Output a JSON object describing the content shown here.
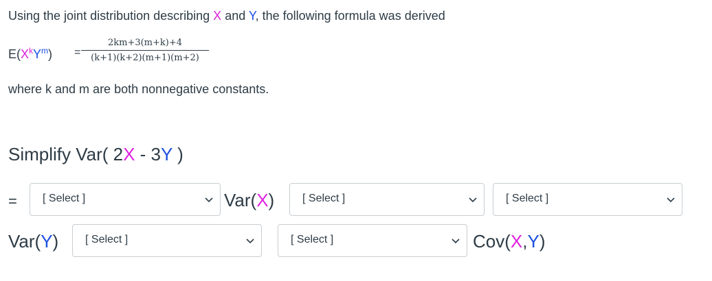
{
  "intro": {
    "part1": "Using the joint distribution describing ",
    "x": "X",
    "part2": " and ",
    "y": "Y",
    "part3": ", the following formula was derived"
  },
  "formula": {
    "lhs_e": "E(",
    "lhs_x": "X",
    "lhs_k": "k",
    "lhs_y": "Y",
    "lhs_m": "m",
    "lhs_close": ")",
    "equals": "=",
    "numerator": "2km+3(m+k)+4",
    "denominator": "(k+1)(k+2)(m+1)(m+2)"
  },
  "where_text": "where k and m are both nonnegative constants.",
  "question": {
    "prefix": "Simplify Var( 2",
    "x": "X",
    "mid": " - 3",
    "y": "Y",
    "suffix": " )"
  },
  "answer": {
    "equals": "=",
    "var_x_prefix": "Var(",
    "var_x": "X",
    "var_x_suffix": ")",
    "var_y_prefix": "Var(",
    "var_y": "Y",
    "var_y_suffix": ")",
    "cov_prefix": "Cov(",
    "cov_x": "X",
    "cov_sep": ",",
    "cov_y": "Y",
    "cov_suffix": ")"
  },
  "selects": [
    {
      "value": "[ Select ]"
    },
    {
      "value": "[ Select ]"
    },
    {
      "value": "[ Select ]"
    },
    {
      "value": "[ Select ]"
    },
    {
      "value": "[ Select ]"
    }
  ],
  "colors": {
    "x": "#e020e0",
    "y": "#1a4fe0",
    "text": "#2d3b45",
    "border": "#c7cdd1"
  }
}
